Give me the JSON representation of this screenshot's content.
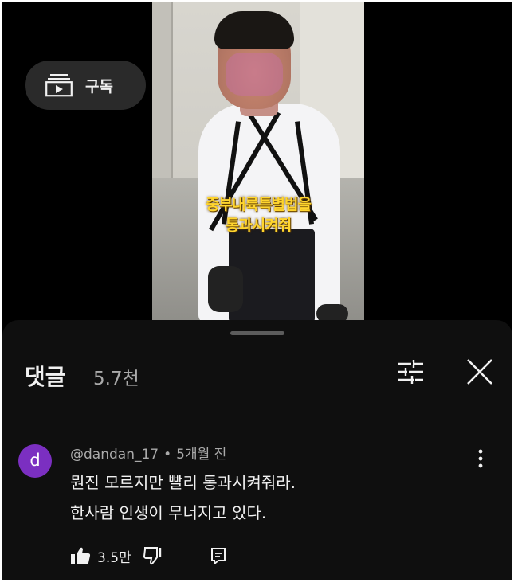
{
  "video": {
    "caption_line1": "중부내륙특별법을",
    "caption_line2": "통과시켜줘"
  },
  "subscribe": {
    "label": "구독",
    "icon": "subscriptions-icon"
  },
  "comments_sheet": {
    "title": "댓글",
    "count": "5.7천",
    "filter_icon": "sliders-icon",
    "close_icon": "close-icon"
  },
  "comment": {
    "avatar_letter": "d",
    "avatar_color": "#7b2fc1",
    "author": "@dandan_17",
    "separator": "•",
    "time": "5개월 전",
    "line1": "뭔진 모르지만 빨리 통과시켜줘라.",
    "line2": "한사람 인생이 무너지고 있다.",
    "like_count": "3.5만"
  },
  "colors": {
    "background": "#000000",
    "sheet": "#0f0f0f",
    "caption": "#ffd52e",
    "secondary_text": "#aaaaaa"
  }
}
